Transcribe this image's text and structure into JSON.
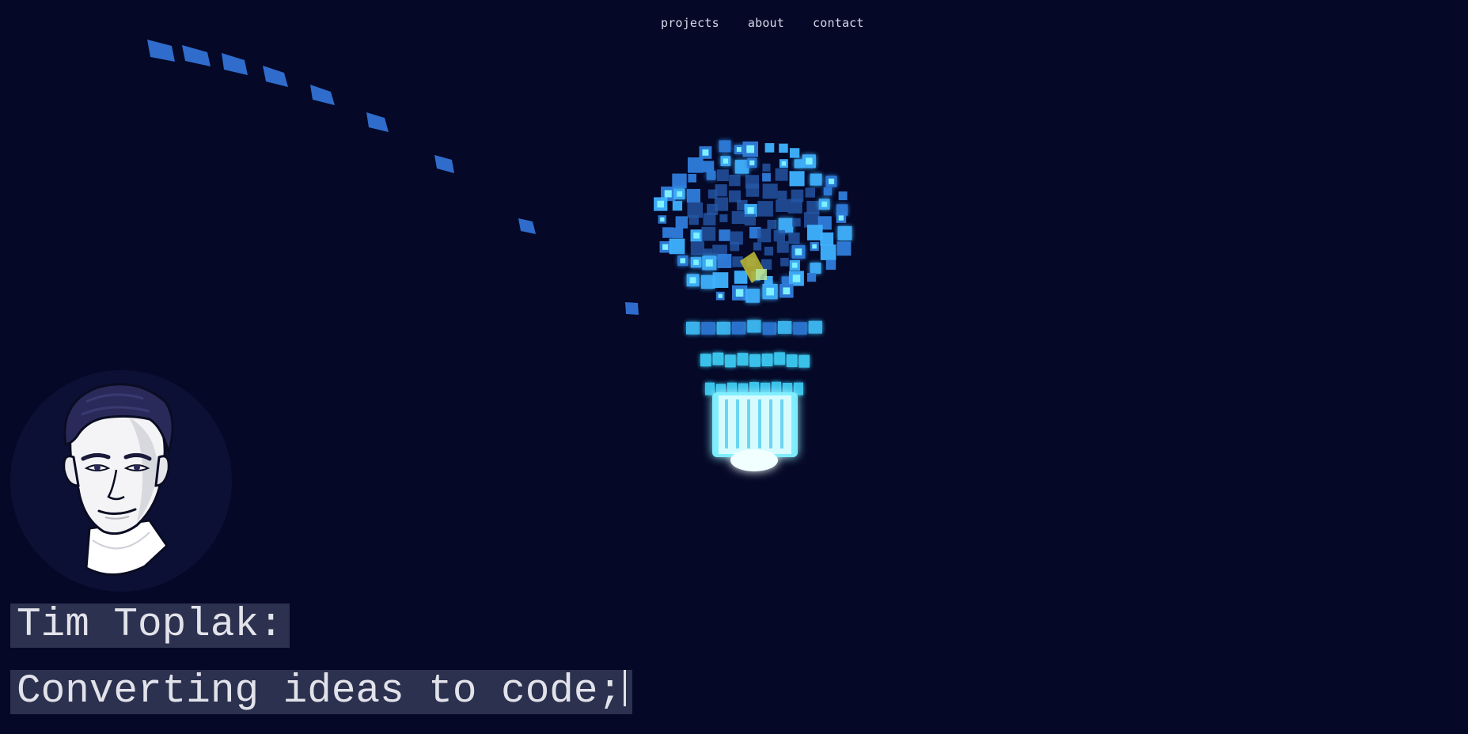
{
  "nav": {
    "items": [
      {
        "label": "projects"
      },
      {
        "label": "about"
      },
      {
        "label": "contact"
      }
    ]
  },
  "hero": {
    "name": "Tim Toplak:",
    "tagline": "Converting ideas to code;"
  },
  "colors": {
    "background": "#050826",
    "pixel_blue": "#2f6ccc",
    "pixel_cyan": "#3fd6ff",
    "pixel_glow": "#cfffff",
    "highlight_yellow": "#b7b534",
    "avatar_bg": "#0d1035"
  },
  "icons": {
    "illustration": "lightbulb-of-pixels",
    "avatar": "portrait-illustration"
  }
}
